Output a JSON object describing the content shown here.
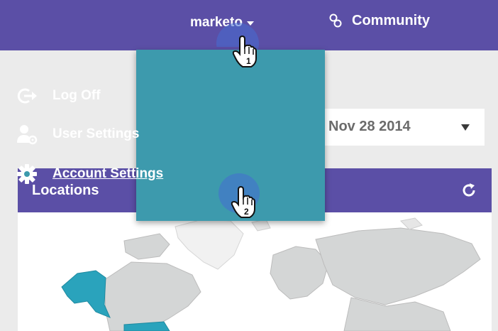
{
  "header": {
    "account_label": "marketo",
    "community_label": "Community"
  },
  "account_menu": {
    "items": [
      {
        "label": "Log Off",
        "icon": "log-off-icon"
      },
      {
        "label": "User Settings",
        "icon": "user-settings-icon"
      },
      {
        "label": "Account Settings",
        "icon": "gear-icon"
      }
    ]
  },
  "date_filter": {
    "value": "Nov 28 2014"
  },
  "locations_panel": {
    "title": "Locations"
  },
  "annotations": {
    "step_1": "1",
    "step_2": "2"
  },
  "colors": {
    "brand_purple": "#5b4fa6",
    "menu_teal": "#3d9aad",
    "map_highlight": "#2aa3bc"
  }
}
